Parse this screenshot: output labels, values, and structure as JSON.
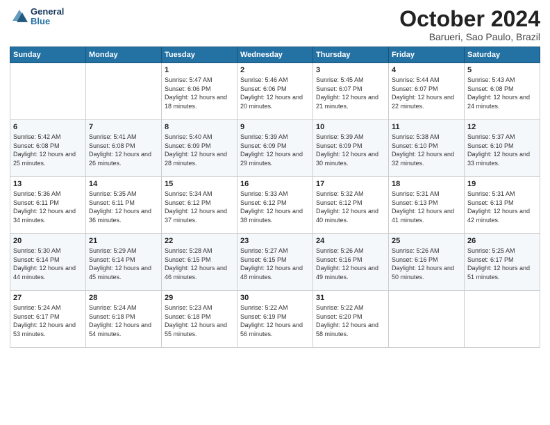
{
  "logo": {
    "line1": "General",
    "line2": "Blue"
  },
  "title": "October 2024",
  "subtitle": "Barueri, Sao Paulo, Brazil",
  "days_of_week": [
    "Sunday",
    "Monday",
    "Tuesday",
    "Wednesday",
    "Thursday",
    "Friday",
    "Saturday"
  ],
  "weeks": [
    [
      {
        "day": "",
        "info": ""
      },
      {
        "day": "",
        "info": ""
      },
      {
        "day": "1",
        "info": "Sunrise: 5:47 AM\nSunset: 6:06 PM\nDaylight: 12 hours and 18 minutes."
      },
      {
        "day": "2",
        "info": "Sunrise: 5:46 AM\nSunset: 6:06 PM\nDaylight: 12 hours and 20 minutes."
      },
      {
        "day": "3",
        "info": "Sunrise: 5:45 AM\nSunset: 6:07 PM\nDaylight: 12 hours and 21 minutes."
      },
      {
        "day": "4",
        "info": "Sunrise: 5:44 AM\nSunset: 6:07 PM\nDaylight: 12 hours and 22 minutes."
      },
      {
        "day": "5",
        "info": "Sunrise: 5:43 AM\nSunset: 6:08 PM\nDaylight: 12 hours and 24 minutes."
      }
    ],
    [
      {
        "day": "6",
        "info": "Sunrise: 5:42 AM\nSunset: 6:08 PM\nDaylight: 12 hours and 25 minutes."
      },
      {
        "day": "7",
        "info": "Sunrise: 5:41 AM\nSunset: 6:08 PM\nDaylight: 12 hours and 26 minutes."
      },
      {
        "day": "8",
        "info": "Sunrise: 5:40 AM\nSunset: 6:09 PM\nDaylight: 12 hours and 28 minutes."
      },
      {
        "day": "9",
        "info": "Sunrise: 5:39 AM\nSunset: 6:09 PM\nDaylight: 12 hours and 29 minutes."
      },
      {
        "day": "10",
        "info": "Sunrise: 5:39 AM\nSunset: 6:09 PM\nDaylight: 12 hours and 30 minutes."
      },
      {
        "day": "11",
        "info": "Sunrise: 5:38 AM\nSunset: 6:10 PM\nDaylight: 12 hours and 32 minutes."
      },
      {
        "day": "12",
        "info": "Sunrise: 5:37 AM\nSunset: 6:10 PM\nDaylight: 12 hours and 33 minutes."
      }
    ],
    [
      {
        "day": "13",
        "info": "Sunrise: 5:36 AM\nSunset: 6:11 PM\nDaylight: 12 hours and 34 minutes."
      },
      {
        "day": "14",
        "info": "Sunrise: 5:35 AM\nSunset: 6:11 PM\nDaylight: 12 hours and 36 minutes."
      },
      {
        "day": "15",
        "info": "Sunrise: 5:34 AM\nSunset: 6:12 PM\nDaylight: 12 hours and 37 minutes."
      },
      {
        "day": "16",
        "info": "Sunrise: 5:33 AM\nSunset: 6:12 PM\nDaylight: 12 hours and 38 minutes."
      },
      {
        "day": "17",
        "info": "Sunrise: 5:32 AM\nSunset: 6:12 PM\nDaylight: 12 hours and 40 minutes."
      },
      {
        "day": "18",
        "info": "Sunrise: 5:31 AM\nSunset: 6:13 PM\nDaylight: 12 hours and 41 minutes."
      },
      {
        "day": "19",
        "info": "Sunrise: 5:31 AM\nSunset: 6:13 PM\nDaylight: 12 hours and 42 minutes."
      }
    ],
    [
      {
        "day": "20",
        "info": "Sunrise: 5:30 AM\nSunset: 6:14 PM\nDaylight: 12 hours and 44 minutes."
      },
      {
        "day": "21",
        "info": "Sunrise: 5:29 AM\nSunset: 6:14 PM\nDaylight: 12 hours and 45 minutes."
      },
      {
        "day": "22",
        "info": "Sunrise: 5:28 AM\nSunset: 6:15 PM\nDaylight: 12 hours and 46 minutes."
      },
      {
        "day": "23",
        "info": "Sunrise: 5:27 AM\nSunset: 6:15 PM\nDaylight: 12 hours and 48 minutes."
      },
      {
        "day": "24",
        "info": "Sunrise: 5:26 AM\nSunset: 6:16 PM\nDaylight: 12 hours and 49 minutes."
      },
      {
        "day": "25",
        "info": "Sunrise: 5:26 AM\nSunset: 6:16 PM\nDaylight: 12 hours and 50 minutes."
      },
      {
        "day": "26",
        "info": "Sunrise: 5:25 AM\nSunset: 6:17 PM\nDaylight: 12 hours and 51 minutes."
      }
    ],
    [
      {
        "day": "27",
        "info": "Sunrise: 5:24 AM\nSunset: 6:17 PM\nDaylight: 12 hours and 53 minutes."
      },
      {
        "day": "28",
        "info": "Sunrise: 5:24 AM\nSunset: 6:18 PM\nDaylight: 12 hours and 54 minutes."
      },
      {
        "day": "29",
        "info": "Sunrise: 5:23 AM\nSunset: 6:18 PM\nDaylight: 12 hours and 55 minutes."
      },
      {
        "day": "30",
        "info": "Sunrise: 5:22 AM\nSunset: 6:19 PM\nDaylight: 12 hours and 56 minutes."
      },
      {
        "day": "31",
        "info": "Sunrise: 5:22 AM\nSunset: 6:20 PM\nDaylight: 12 hours and 58 minutes."
      },
      {
        "day": "",
        "info": ""
      },
      {
        "day": "",
        "info": ""
      }
    ]
  ]
}
